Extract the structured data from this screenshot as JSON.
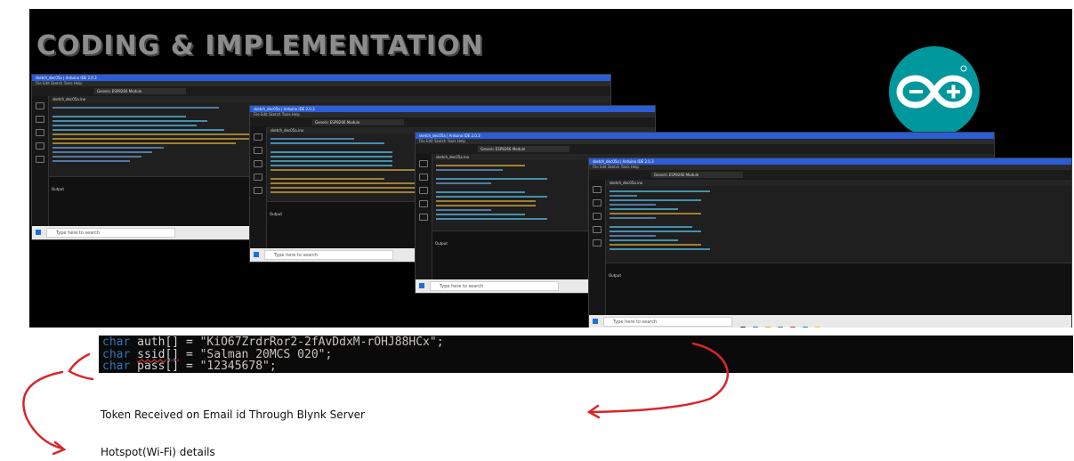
{
  "slide": {
    "title": "CODING & IMPLEMENTATION"
  },
  "windows": [
    {
      "titlebar": "sketch_dec05a | Arduino IDE 2.0.3",
      "menu": "File  Edit  Sketch  Tools  Help",
      "board": "Generic ESP8266 Module",
      "tab": "sketch_dec05a.ino",
      "output_label": "Output",
      "search": "Type here to search"
    },
    {
      "titlebar": "sketch_dec05a | Arduino IDE 2.0.3",
      "menu": "File  Edit  Sketch  Tools  Help",
      "board": "Generic ESP8266 Module",
      "tab": "sketch_dec05a.ino",
      "output_label": "Output",
      "search": "Type here to search"
    },
    {
      "titlebar": "sketch_dec05a | Arduino IDE 2.0.3",
      "menu": "File  Edit  Sketch  Tools  Help",
      "board": "Generic ESP8266 Module",
      "tab": "sketch_dec05a.ino",
      "output_label": "Output",
      "search": "Type here to search"
    },
    {
      "titlebar": "sketch_dec05a | Arduino IDE 2.0.3",
      "menu": "File  Edit  Sketch  Tools  Help",
      "board": "Generic ESP8266 Module",
      "tab": "sketch_dec05a.ino",
      "output_label": "Output",
      "search": "Type here to search"
    }
  ],
  "code": {
    "keyword": "char",
    "line1_var": "auth[]",
    "line1_val": "\"KiO67ZrdrRor2-2fAvDdxM-rOHJ88HCx\";",
    "line2_var": "ssid[]",
    "line2_val": "\"Salman 20MCS 020\";",
    "line3_var": "pass[]",
    "line3_val": "\"12345678\";",
    "equals": "="
  },
  "annotations": {
    "token": "Token Received on Email id Through Blynk Server",
    "hotspot": "Hotspot(Wi-Fi) details"
  },
  "colors": {
    "arrow": "#d8262a",
    "logo": "#00979d",
    "keyword": "#2e77b7"
  },
  "icons": [
    "arduino-logo-icon",
    "arrow-icon",
    "windows-start-icon"
  ]
}
